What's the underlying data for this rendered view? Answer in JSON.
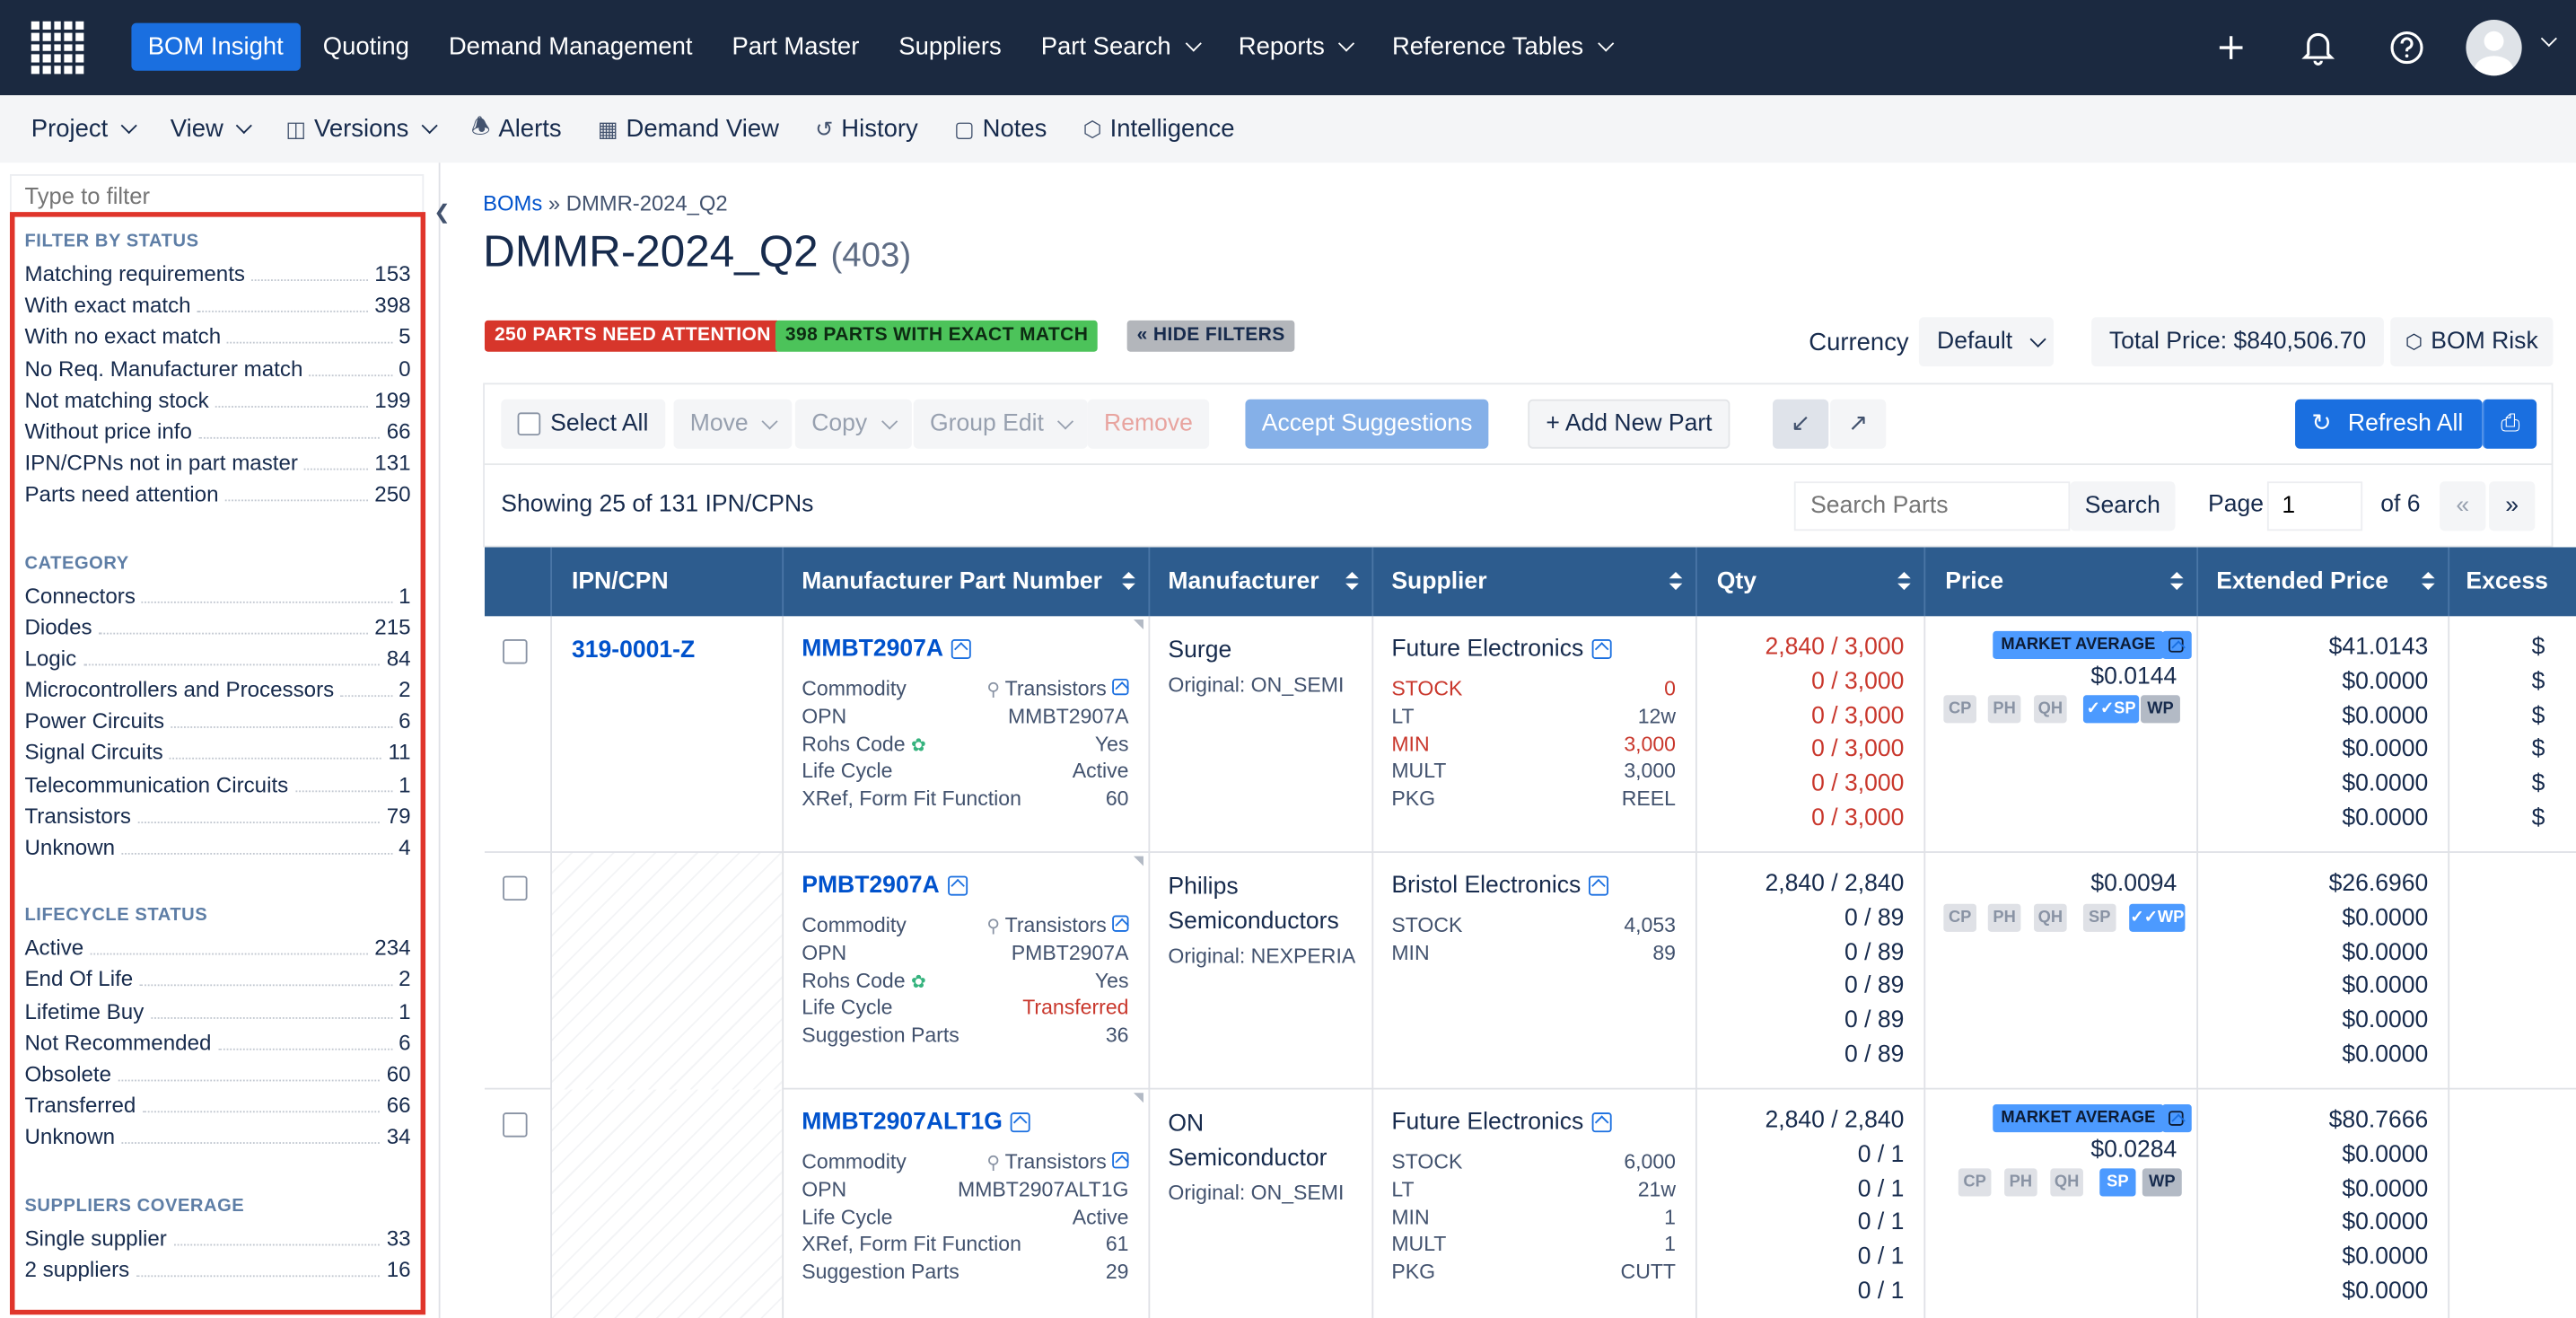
{
  "topnav": {
    "items": [
      "BOM Insight",
      "Quoting",
      "Demand Management",
      "Part Master",
      "Suppliers",
      "Part Search",
      "Reports",
      "Reference Tables"
    ],
    "dropdown_items": [
      "Part Search",
      "Reports",
      "Reference Tables"
    ],
    "active": "BOM Insight",
    "icons": [
      "apps-grid-icon",
      "plus-icon",
      "bell-icon",
      "help-icon",
      "avatar"
    ]
  },
  "subnav": {
    "project": "Project",
    "view": "View",
    "versions": "Versions",
    "alerts": "Alerts",
    "demand_view": "Demand View",
    "history": "History",
    "notes": "Notes",
    "intelligence": "Intelligence"
  },
  "sidebar": {
    "filter_placeholder": "Type to filter",
    "sections": [
      {
        "title": "FILTER BY STATUS",
        "items": [
          {
            "label": "Matching requirements",
            "count": "153"
          },
          {
            "label": "With exact match",
            "count": "398"
          },
          {
            "label": "With no exact match",
            "count": "5"
          },
          {
            "label": "No Req. Manufacturer match",
            "count": "0"
          },
          {
            "label": "Not matching stock",
            "count": "199"
          },
          {
            "label": "Without price info",
            "count": "66"
          },
          {
            "label": "IPN/CPNs not in part master",
            "count": "131"
          },
          {
            "label": "Parts need attention",
            "count": "250"
          }
        ]
      },
      {
        "title": "CATEGORY",
        "items": [
          {
            "label": "Connectors",
            "count": "1"
          },
          {
            "label": "Diodes",
            "count": "215"
          },
          {
            "label": "Logic",
            "count": "84"
          },
          {
            "label": "Microcontrollers and Processors",
            "count": "2"
          },
          {
            "label": "Power Circuits",
            "count": "6"
          },
          {
            "label": "Signal Circuits",
            "count": "11"
          },
          {
            "label": "Telecommunication Circuits",
            "count": "1"
          },
          {
            "label": "Transistors",
            "count": "79"
          },
          {
            "label": "Unknown",
            "count": "4"
          }
        ]
      },
      {
        "title": "LIFECYCLE STATUS",
        "items": [
          {
            "label": "Active",
            "count": "234"
          },
          {
            "label": "End Of Life",
            "count": "2"
          },
          {
            "label": "Lifetime Buy",
            "count": "1"
          },
          {
            "label": "Not Recommended",
            "count": "6"
          },
          {
            "label": "Obsolete",
            "count": "60"
          },
          {
            "label": "Transferred",
            "count": "66"
          },
          {
            "label": "Unknown",
            "count": "34"
          }
        ]
      },
      {
        "title": "SUPPLIERS COVERAGE",
        "items": [
          {
            "label": "Single supplier",
            "count": "33"
          },
          {
            "label": "2 suppliers",
            "count": "16"
          }
        ]
      }
    ]
  },
  "breadcrumb": {
    "root": "BOMs",
    "sep": "»",
    "current": "DMMR-2024_Q2"
  },
  "page": {
    "title": "DMMR-2024_Q2",
    "count": "(403)"
  },
  "tags": {
    "attention": "250 PARTS NEED ATTENTION",
    "exact": "398 PARTS WITH EXACT MATCH",
    "hide": "« HIDE FILTERS"
  },
  "currency": {
    "label": "Currency",
    "value": "Default"
  },
  "total_price": "Total Price: $840,506.70",
  "bom_risk": "BOM Risk",
  "toolbar": {
    "select_all": "Select All",
    "move": "Move",
    "copy": "Copy",
    "group_edit": "Group Edit",
    "remove": "Remove",
    "accept": "Accept Suggestions",
    "add": "+ Add New Part",
    "refresh": "Refresh All"
  },
  "listing": {
    "showing": "Showing 25 of 131 IPN/CPNs",
    "search_placeholder": "Search Parts",
    "search_btn": "Search",
    "page_label": "Page",
    "page_value": "1",
    "of": "of 6",
    "prev": "«",
    "next": "»"
  },
  "columns": [
    "IPN/CPN",
    "Manufacturer Part Number",
    "Manufacturer",
    "Supplier",
    "Qty",
    "Price",
    "Extended Price",
    "Excess"
  ],
  "rows": [
    {
      "ipn": "319-0001-Z",
      "mpn": "MMBT2907A",
      "attrs": [
        [
          "Commodity",
          "Transistors"
        ],
        [
          "OPN",
          "MMBT2907A"
        ],
        [
          "Rohs Code",
          "Yes"
        ],
        [
          "Life Cycle",
          "Active"
        ],
        [
          "XRef, Form Fit Function",
          "60"
        ]
      ],
      "manufacturer": "Surge",
      "original": "Original: ON_SEMI",
      "supplier": "Future Electronics",
      "supplier_attrs": [
        [
          "STOCK",
          "0"
        ],
        [
          "LT",
          "12w"
        ],
        [
          "MIN",
          "3,000"
        ],
        [
          "MULT",
          "3,000"
        ],
        [
          "PKG",
          "REEL"
        ]
      ],
      "qty": [
        "2,840 / 3,000",
        "0 / 3,000",
        "0 / 3,000",
        "0 / 3,000",
        "0 / 3,000",
        "0 / 3,000"
      ],
      "market_badge": "MARKET AVERAGE",
      "price": "$0.0144",
      "chips": [
        "CP",
        "PH",
        "QH",
        "SP",
        "WP"
      ],
      "ext": [
        "$41.0143",
        "$0.0000",
        "$0.0000",
        "$0.0000",
        "$0.0000",
        "$0.0000"
      ],
      "excess": [
        "$",
        "$",
        "$",
        "$",
        "$",
        "$"
      ]
    },
    {
      "ipn": "",
      "mpn": "PMBT2907A",
      "attrs": [
        [
          "Commodity",
          "Transistors"
        ],
        [
          "OPN",
          "PMBT2907A"
        ],
        [
          "Rohs Code",
          "Yes"
        ],
        [
          "Life Cycle",
          "Transferred"
        ],
        [
          "Suggestion Parts",
          "36"
        ]
      ],
      "manufacturer": "Philips Semiconductors",
      "original": "Original: NEXPERIA",
      "supplier": "Bristol Electronics",
      "supplier_attrs": [
        [
          "STOCK",
          "4,053"
        ],
        [
          "MIN",
          "89"
        ]
      ],
      "qty": [
        "2,840 / 2,840",
        "0 / 89",
        "0 / 89",
        "0 / 89",
        "0 / 89",
        "0 / 89"
      ],
      "market_badge": "",
      "price": "$0.0094",
      "chips": [
        "CP",
        "PH",
        "QH",
        "SP",
        "WP"
      ],
      "ext": [
        "$26.6960",
        "$0.0000",
        "$0.0000",
        "$0.0000",
        "$0.0000",
        "$0.0000"
      ]
    },
    {
      "ipn": "",
      "mpn": "MMBT2907ALT1G",
      "attrs": [
        [
          "Commodity",
          "Transistors"
        ],
        [
          "OPN",
          "MMBT2907ALT1G"
        ],
        [
          "Life Cycle",
          "Active"
        ],
        [
          "XRef, Form Fit Function",
          "61"
        ],
        [
          "Suggestion Parts",
          "29"
        ]
      ],
      "manufacturer": "ON Semiconductor",
      "original": "Original: ON_SEMI",
      "supplier": "Future Electronics",
      "supplier_attrs": [
        [
          "STOCK",
          "6,000"
        ],
        [
          "LT",
          "21w"
        ],
        [
          "MIN",
          "1"
        ],
        [
          "MULT",
          "1"
        ],
        [
          "PKG",
          "CUTT"
        ]
      ],
      "qty": [
        "2,840 / 2,840",
        "0 / 1",
        "0 / 1",
        "0 / 1",
        "0 / 1",
        "0 / 1"
      ],
      "market_badge": "MARKET AVERAGE",
      "price": "$0.0284",
      "chips": [
        "CP",
        "PH",
        "QH",
        "SP",
        "WP"
      ],
      "ext": [
        "$80.7666",
        "$0.0000",
        "$0.0000",
        "$0.0000",
        "$0.0000",
        "$0.0000"
      ]
    }
  ],
  "colors": {
    "topbar": "#1b2940",
    "accent": "#1a6fe0",
    "attention": "#de350b",
    "exact": "#36b37e",
    "header": "#2d5c8e",
    "highlight": "#e0352b"
  }
}
